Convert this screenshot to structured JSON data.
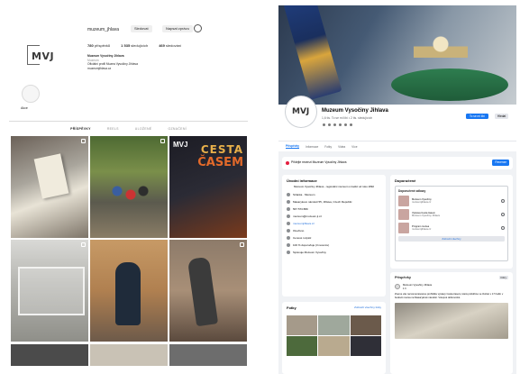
{
  "instagram": {
    "username": "muzeum_jhlava",
    "buttons": {
      "follow": "Sledovat",
      "message": "Napsat zprávu"
    },
    "stats": [
      {
        "value": "780",
        "label": "příspěvků"
      },
      {
        "value": "1 535",
        "label": "sledujících"
      },
      {
        "value": "469",
        "label": "sledování"
      }
    ],
    "bio": {
      "name": "Muzeum Vysočiny Jihlava",
      "category": "Muzeum",
      "line1": "Oficiální profil Muzea Vysočiny Jihlava",
      "line2": "muzeumjihlava.cz"
    },
    "logo_text": "MVJ",
    "highlight_label": "Akce",
    "tabs": [
      "PŘÍSPĚVKY",
      "REELS",
      "ULOŽENÉ",
      "OZNAČENÍ"
    ],
    "poster": {
      "logo": "MVJ",
      "title": "CESTA",
      "subtitle": "ČASEM"
    }
  },
  "facebook": {
    "page_title": "Muzeum Vysočiny Jihlava",
    "page_sub": "1,6 tis. To se mi líbí • 2 tis. sledujících",
    "avatar_text": "MVJ",
    "btn_primary": "To se mi líbí",
    "btn_secondary": "Hledat",
    "nav": [
      "Příspěvky",
      "Informace",
      "Fotky",
      "Videa",
      "Více"
    ],
    "composer": {
      "text": "Přidejte recenzi Muzeum Vysočiny Jihlava",
      "button": "Recenze"
    },
    "intro": {
      "title": "Úvodní informace",
      "desc": "Muzeum Vysočiny Jihlava - regionální muzeum s tradicí od roku 1892",
      "rows": [
        {
          "text": "Stránka · Muzeum",
          "link": false
        },
        {
          "text": "Masarykovo náměstí 55, Jihlava, Czech Republic",
          "link": false
        },
        {
          "text": "567 573 880",
          "link": false
        },
        {
          "text": "muzeum@muzeum.ji.cz",
          "link": false
        },
        {
          "text": "muzeumjihlava.cz",
          "link": true
        },
        {
          "text": "Otevřeno",
          "link": false
        },
        {
          "text": "Cenové rozpětí",
          "link": false
        }
      ],
      "footer_rows": [
        {
          "text": "100 % doporučuje (3 recenze)"
        },
        {
          "text": "Spravuje Muzeum Vysočiny"
        }
      ]
    },
    "photos": {
      "title": "Fotky",
      "link": "Zobrazit všechny fotky"
    },
    "featured": {
      "title": "Doporučené",
      "inner_label": "Doporučené odkazy",
      "items": [
        {
          "title": "Muzeum Vysočiny",
          "sub": "muzeumjihlava.cz"
        },
        {
          "title": "Výstava Cesta časem",
          "sub": "Muzeum Vysočiny Jihlava"
        },
        {
          "title": "Program muzea",
          "sub": "muzeumjihlava.cz"
        }
      ],
      "button": "Zobrazit všechny"
    },
    "posts": {
      "title": "Příspěvky",
      "filter": "Filtry",
      "author": "Muzeum Vysočiny Jihlava",
      "date": "1 h",
      "text": "Zveme vás na komentovanou prohlídku výstavy Cesta časem, která proběhne ve čtvrtek v 17 hodin v budově muzea na Masarykově náměstí. Vstupné dobrovolné."
    }
  }
}
